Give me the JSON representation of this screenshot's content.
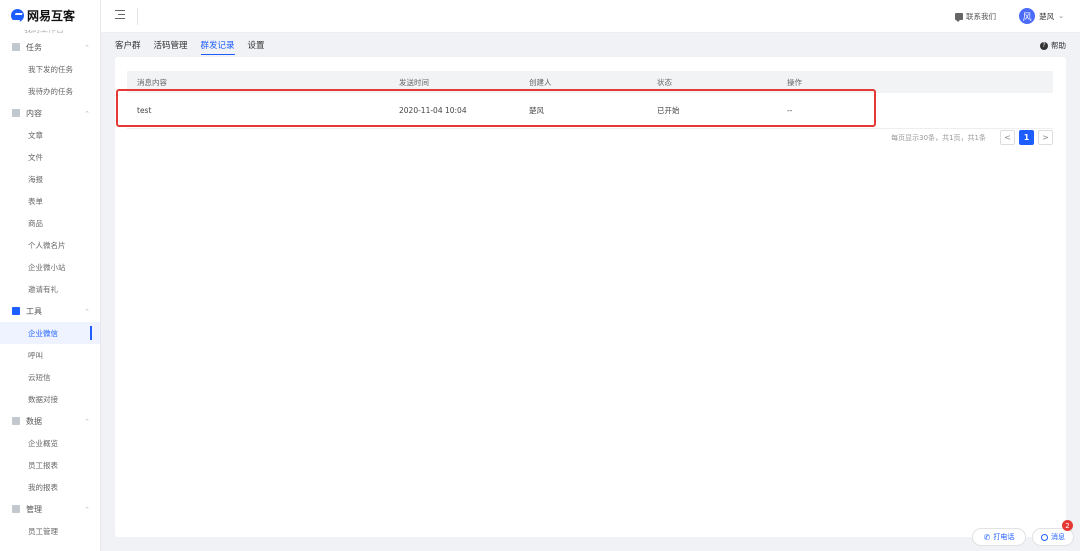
{
  "app": {
    "logo_text": "网易互客"
  },
  "sidebar": {
    "cutoff_text": "我的工作台",
    "groups": [
      {
        "label": "任务",
        "icon": "task-icon",
        "items": [
          "我下发的任务",
          "我待办的任务"
        ]
      },
      {
        "label": "内容",
        "icon": "content-icon",
        "items": [
          "文章",
          "文件",
          "海报",
          "表单",
          "商品",
          "个人微名片",
          "企业微小站",
          "邀请有礼"
        ]
      },
      {
        "label": "工具",
        "icon": "tools-icon",
        "items": [
          "企业微信",
          "呼叫",
          "云短信",
          "数据对接"
        ]
      },
      {
        "label": "数据",
        "icon": "data-icon",
        "items": [
          "企业概览",
          "员工报表",
          "我的报表"
        ]
      },
      {
        "label": "管理",
        "icon": "settings-icon",
        "items": [
          "员工管理"
        ]
      }
    ],
    "active_item": "企业微信"
  },
  "topbar": {
    "contact_label": "联系我们",
    "user_avatar": "风",
    "user_name": "楚风"
  },
  "tabs": [
    "客户群",
    "活码管理",
    "群发记录",
    "设置"
  ],
  "active_tab": "群发记录",
  "help_label": "帮助",
  "table": {
    "columns": [
      "消息内容",
      "发送时间",
      "创建人",
      "状态",
      "操作"
    ],
    "rows": [
      {
        "content": "test",
        "time": "2020-11-04 10:04",
        "creator": "楚风",
        "status": "已开始",
        "action": "--"
      }
    ]
  },
  "pagination": {
    "info": "每页显示30条，共1页，共1条",
    "prev": "<",
    "current": "1",
    "next": ">"
  },
  "floating": {
    "call_label": "打电话",
    "msg_label": "消息",
    "msg_badge": "2"
  },
  "colors": {
    "accent": "#1e5eff",
    "highlight": "#e53935"
  }
}
